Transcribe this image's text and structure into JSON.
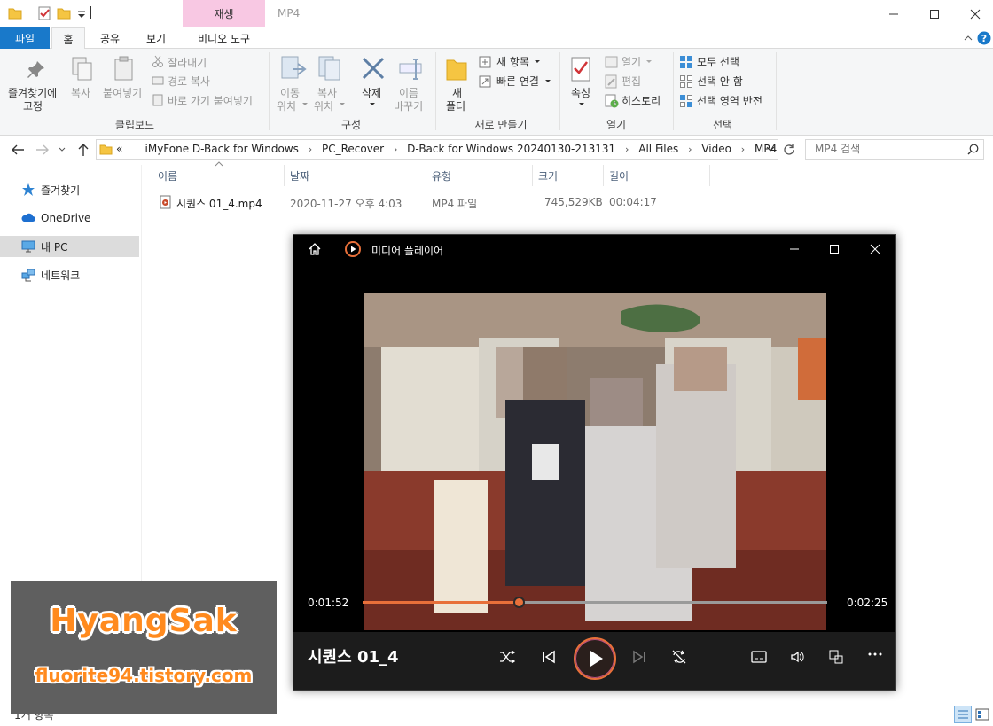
{
  "titlebar": {
    "context_tab": "재생",
    "window_title": "MP4"
  },
  "tabs": {
    "file": "파일",
    "home": "홈",
    "share": "공유",
    "view": "보기",
    "video_tools": "비디오 도구"
  },
  "ribbon": {
    "pin_label_1": "즐겨찾기에",
    "pin_label_2": "고정",
    "copy": "복사",
    "paste": "붙여넣기",
    "cut": "잘라내기",
    "copy_path": "경로 복사",
    "paste_shortcut": "바로 가기 붙여넣기",
    "clipboard_group": "클립보드",
    "move_to_1": "이동",
    "move_to_2": "위치",
    "copy_to_1": "복사",
    "copy_to_2": "위치",
    "delete": "삭제",
    "rename_1": "이름",
    "rename_2": "바꾸기",
    "organize_group": "구성",
    "new_folder_1": "새",
    "new_folder_2": "폴더",
    "new_item": "새 항목",
    "easy_access": "빠른 연결",
    "new_group": "새로 만들기",
    "properties": "속성",
    "open": "열기",
    "edit": "편집",
    "history": "히스토리",
    "open_group": "열기",
    "select_all": "모두 선택",
    "select_none": "선택 안 함",
    "invert_selection": "선택 영역 반전",
    "select_group": "선택"
  },
  "address": {
    "overflow": "«",
    "crumbs": [
      "iMyFone D-Back for Windows",
      "PC_Recover",
      "D-Back for Windows 20240130-213131",
      "All Files",
      "Video",
      "MP4"
    ],
    "search_placeholder": "MP4 검색"
  },
  "sidebar": {
    "items": [
      {
        "label": "즐겨찾기"
      },
      {
        "label": "OneDrive"
      },
      {
        "label": "내 PC"
      },
      {
        "label": "네트워크"
      }
    ]
  },
  "filelist": {
    "columns": [
      "이름",
      "날짜",
      "유형",
      "크기",
      "길이"
    ],
    "rows": [
      {
        "name": "시퀀스 01_4.mp4",
        "date": "2020-11-27 오후 4:03",
        "type": "MP4 파일",
        "size": "745,529KB",
        "length": "00:04:17"
      }
    ]
  },
  "status": {
    "count": "1개 항목"
  },
  "player": {
    "title": "미디어 플레이어",
    "current_time": "0:01:52",
    "total_time": "0:02:25",
    "progress": 0.336,
    "media_title": "시퀀스 01_4",
    "accent": "#e8703a"
  },
  "watermark": {
    "name": "HyangSak",
    "url": "fluorite94.tistory.com"
  }
}
